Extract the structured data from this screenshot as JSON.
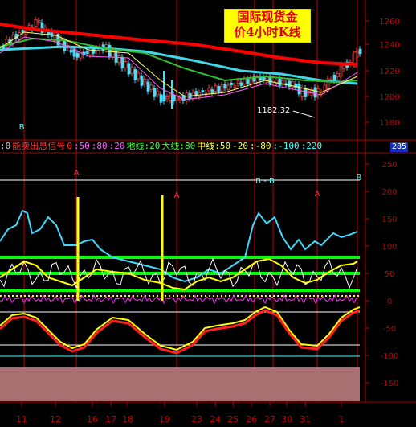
{
  "title": {
    "line1": "国际现货金",
    "line2": "价4小时K线"
  },
  "price_axis": {
    "ticks": [
      "1260",
      "1240",
      "1220",
      "1200",
      "1180"
    ],
    "annotation": "1182.32"
  },
  "indicator_bar": {
    "items": [
      {
        "text": ":0",
        "color": "#d0d0d0"
      },
      {
        "text": "能卖出息信号",
        "color": "#ff3030"
      },
      {
        "text": "0",
        "color": "#ff3030"
      },
      {
        "text": ":50",
        "color": "#ff60ff"
      },
      {
        "text": ":80",
        "color": "#ff60ff"
      },
      {
        "text": ":20",
        "color": "#ff60ff"
      },
      {
        "text": "地线:20",
        "color": "#40ff40"
      },
      {
        "text": "大线:80",
        "color": "#40ff40"
      },
      {
        "text": "中线:50",
        "color": "#ffff40"
      },
      {
        "text": "-20",
        "color": "#ffff40"
      },
      {
        "text": ":-80",
        "color": "#ffff40"
      },
      {
        "text": ":-100",
        "color": "#40ffff"
      },
      {
        "text": ":220",
        "color": "#40ffff"
      }
    ],
    "badge": "285"
  },
  "osc_axis": {
    "ticks": [
      "250",
      "200",
      "150",
      "100",
      "50",
      "0",
      "-50",
      "-100",
      "-150",
      "-200"
    ]
  },
  "signals": {
    "a": "A",
    "b": "B",
    "bb": "B - B"
  },
  "x_axis": {
    "labels": [
      "11",
      "12",
      "16",
      "17",
      "18",
      "19",
      "23",
      "24",
      "25",
      "26",
      "27",
      "30",
      "31",
      "1"
    ]
  },
  "colors": {
    "bg": "#000000",
    "red_ma": "#ff0000",
    "cyan_ma": "#40d8e8",
    "green_ma": "#30c030",
    "yellow": "#ffff00",
    "level_green": "#00ff00",
    "magenta": "#ff30ff",
    "grid": "#ffffff"
  }
}
